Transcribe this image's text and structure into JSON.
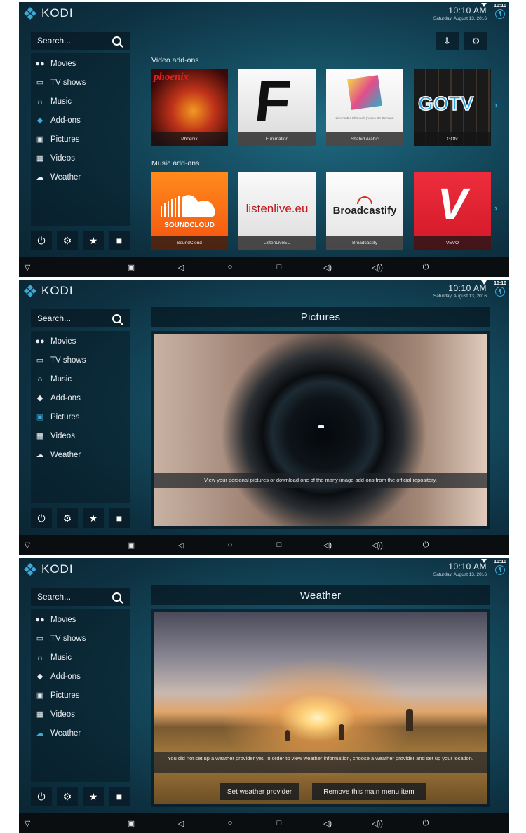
{
  "app": {
    "logo_text": "KODI"
  },
  "status": {
    "time": "10:10 AM",
    "date": "Saturday, August 13, 2016",
    "tiny_time": "10:10"
  },
  "search": {
    "label": "Search..."
  },
  "sidebar": {
    "items": [
      {
        "label": "Movies",
        "icon": "movies-icon"
      },
      {
        "label": "TV shows",
        "icon": "tv-icon"
      },
      {
        "label": "Music",
        "icon": "headphones-icon"
      },
      {
        "label": "Add-ons",
        "icon": "addons-icon"
      },
      {
        "label": "Pictures",
        "icon": "pictures-icon"
      },
      {
        "label": "Videos",
        "icon": "film-icon"
      },
      {
        "label": "Weather",
        "icon": "weather-icon"
      }
    ]
  },
  "screens": [
    {
      "active": "Add-ons",
      "video_section": "Video add-ons",
      "music_section": "Music add-ons",
      "video_addons": [
        "Phoenix",
        "Funimation",
        "Shahid Arabic",
        "GOtv"
      ],
      "music_addons": [
        "SoundCloud",
        "ListenLiveEU",
        "Broadcastify",
        "VEVO"
      ],
      "tile_text": {
        "phoenix": "phoenix",
        "funimation": "F",
        "gotv": "GOTV",
        "soundcloud": "SOUNDCLOUD",
        "listenlive": "listenlive.eu",
        "broadcastify": "Broadcastify",
        "vevo": "V",
        "shahid": "Live Arabic Channels | Video On Demand"
      }
    },
    {
      "active": "Pictures",
      "title": "Pictures",
      "description": "View your personal pictures or download one of the many image add-ons from the official repository."
    },
    {
      "active": "Weather",
      "title": "Weather",
      "description": "You did not set up a weather provider yet. In order to view weather information, choose a weather provider and set up your location.",
      "buttons": [
        "Set weather provider",
        "Remove this main menu item"
      ]
    }
  ],
  "colors": {
    "accent": "#3ca9d6",
    "background": "#0d3040"
  }
}
